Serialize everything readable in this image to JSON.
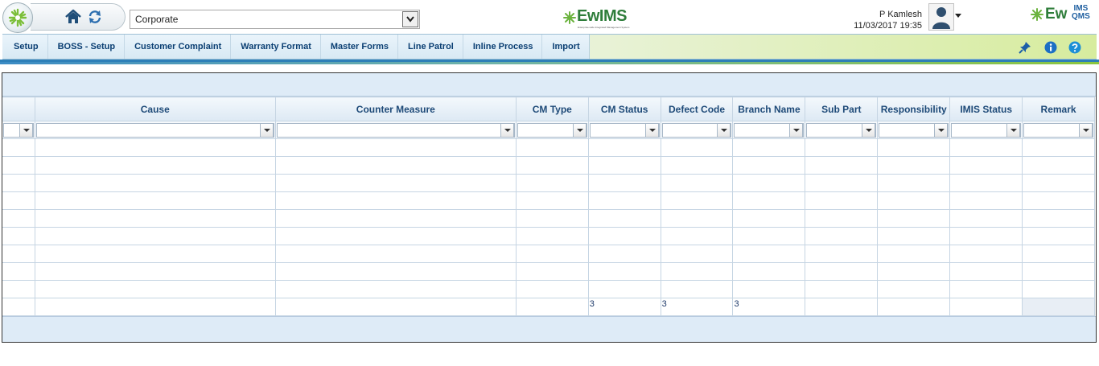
{
  "header": {
    "company_selected": "Corporate",
    "app_logo_text": "EwIMS",
    "app_logo_tagline": "Enterprise-wide Integrated Management System",
    "user_name": "P Kamlesh",
    "datetime": "11/03/2017 19:35",
    "brand_logo_text": "Ew",
    "brand_logo_super": "IMS",
    "brand_logo_sub": "QMS"
  },
  "menu": {
    "items": [
      {
        "label": "Setup"
      },
      {
        "label": "BOSS - Setup"
      },
      {
        "label": "Customer Complaint"
      },
      {
        "label": "Warranty Format"
      },
      {
        "label": "Master Forms"
      },
      {
        "label": "Line Patrol"
      },
      {
        "label": "Inline Process"
      },
      {
        "label": "Import"
      }
    ],
    "icons": [
      "pin-icon",
      "info-icon",
      "help-icon"
    ]
  },
  "grid": {
    "columns": [
      {
        "label": ""
      },
      {
        "label": "Cause"
      },
      {
        "label": "Counter Measure"
      },
      {
        "label": "CM Type"
      },
      {
        "label": "CM Status"
      },
      {
        "label": "Defect Code"
      },
      {
        "label": "Branch Name"
      },
      {
        "label": "Sub Part"
      },
      {
        "label": "Responsibility"
      },
      {
        "label": "IMIS Status"
      },
      {
        "label": "Remark"
      }
    ],
    "empty_rows": 9,
    "footer_values": [
      "",
      "",
      "",
      "",
      "3",
      "3",
      "3",
      "",
      "",
      "",
      ""
    ]
  },
  "colors": {
    "menu_text": "#0b3f73",
    "header_text": "#1e4a78",
    "grid_band": "#deebf7",
    "stripe_blue": "#2d7fb8",
    "stripe_green": "#8cc63f"
  }
}
